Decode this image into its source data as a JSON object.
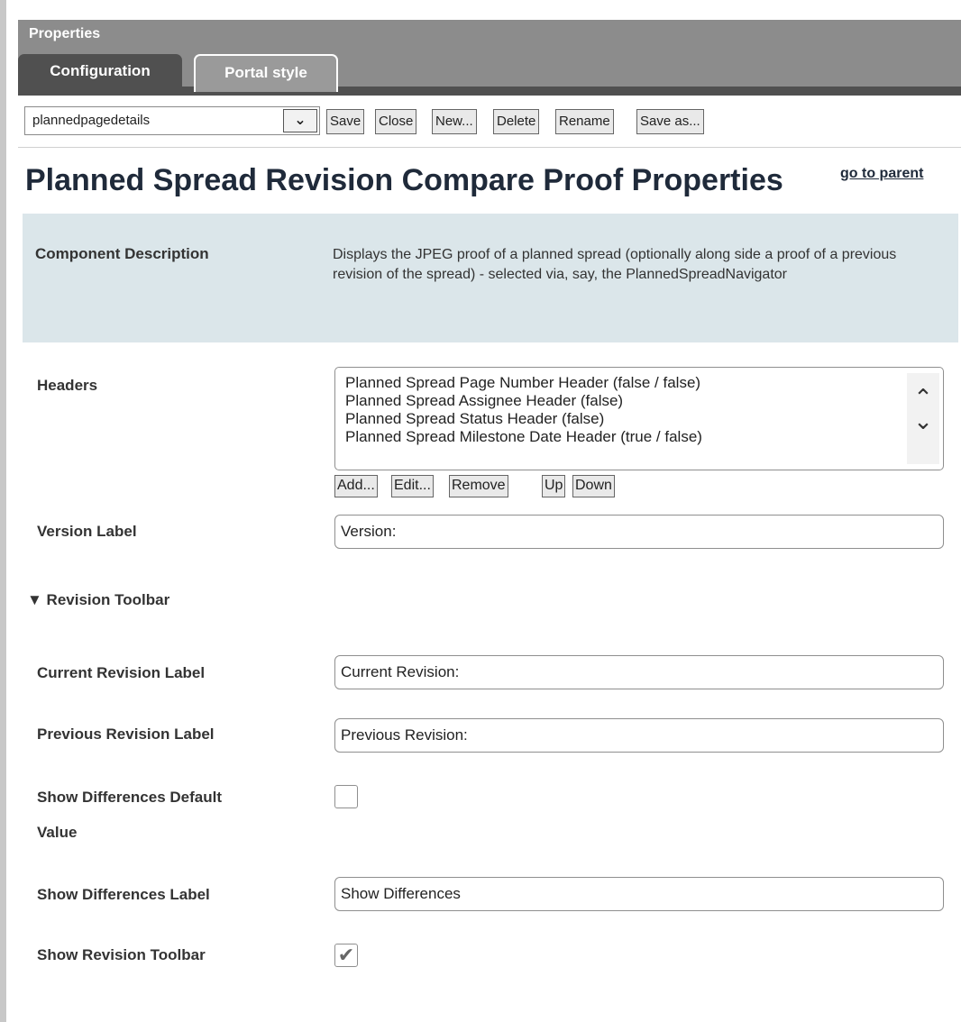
{
  "panel": {
    "title": "Properties"
  },
  "tabs": [
    {
      "label": "Configuration",
      "active": true
    },
    {
      "label": "Portal style",
      "active": false
    }
  ],
  "toolbar": {
    "selected_config": "plannedpagedetails",
    "buttons": {
      "save": "Save",
      "close": "Close",
      "new": "New...",
      "delete": "Delete",
      "rename": "Rename",
      "save_as": "Save as..."
    }
  },
  "page": {
    "title": "Planned Spread Revision Compare Proof Properties",
    "parent_link": "go to parent"
  },
  "description": {
    "label": "Component Description",
    "text": "Displays the JPEG proof of a planned spread (optionally along side a proof of a previous revision of the spread) - selected via, say, the PlannedSpreadNavigator"
  },
  "headers": {
    "label": "Headers",
    "items": [
      "Planned Spread Page Number Header (false / false)",
      "Planned Spread Assignee Header (false)",
      "Planned Spread Status Header (false)",
      "Planned Spread Milestone Date Header (true / false)"
    ],
    "buttons": {
      "add": "Add...",
      "edit": "Edit...",
      "remove": "Remove",
      "up": "Up",
      "down": "Down"
    }
  },
  "version": {
    "label": "Version Label",
    "value": "Version:"
  },
  "revision_toolbar": {
    "section_label": "▼ Revision Toolbar",
    "current_label": {
      "label": "Current Revision Label",
      "value": "Current Revision:"
    },
    "previous_label": {
      "label": "Previous Revision Label",
      "value": "Previous Revision:"
    },
    "show_diff_default": {
      "label_line1": "Show Differences Default",
      "label_line2": "Value",
      "checked": false
    },
    "show_diff_label": {
      "label": "Show Differences Label",
      "value": "Show Differences"
    },
    "show_toolbar": {
      "label": "Show Revision Toolbar",
      "checked": true
    }
  },
  "colors": {
    "header_gray": "#8c8c8c",
    "tab_dark": "#505050",
    "description_bg": "#dbe6ea",
    "title_text": "#1f2a3a"
  }
}
